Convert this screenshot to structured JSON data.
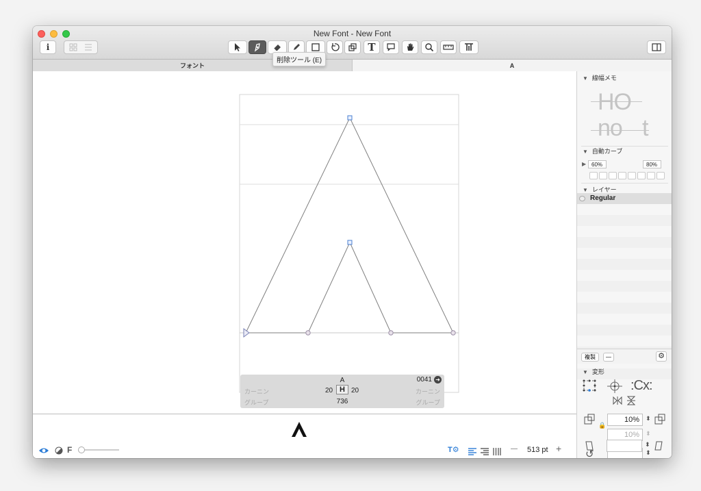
{
  "window": {
    "title": "New Font - New Font"
  },
  "toolbar": {
    "info_label": "i",
    "tooltip": "削除ツール (E)",
    "icons": [
      "info-icon",
      "grid-view-icon",
      "list-view-icon",
      "select-tool-icon",
      "node-tool-icon",
      "eraser-tool-icon",
      "pencil-tool-icon",
      "rectangle-tool-icon",
      "rotate-tool-icon",
      "scale-tool-icon",
      "text-tool-icon",
      "annotation-tool-icon",
      "hand-tool-icon",
      "zoom-tool-icon",
      "measure-tool-icon",
      "metrics-tool-icon",
      "sidebar-toggle-icon"
    ]
  },
  "tabs": [
    {
      "label": "フォント"
    },
    {
      "label": "A"
    }
  ],
  "glyph_info": {
    "name": "A",
    "unicode": "0041",
    "left_kern_label": "カーニン",
    "right_kern_label": "カーニン",
    "lsb": "20",
    "rsb": "20",
    "width": "736",
    "left_group_label": "グループ",
    "right_group_label": "グループ"
  },
  "panel": {
    "stem_memo": {
      "title": "線幅メモ",
      "sample1": "HO",
      "sample2": "no",
      "sample3": "t"
    },
    "auto_curve": {
      "title": "自動カーブ",
      "left_value": "60%",
      "right_value": "80%"
    },
    "layers": {
      "title": "レイヤー",
      "items": [
        {
          "name": "Regular"
        }
      ]
    },
    "copy_button": "複製",
    "minus_button": "—",
    "transform": {
      "title": "変形",
      "scale_value": "10%",
      "scale_value2": "10%",
      "rotate_value": "",
      "slant_value": ""
    }
  },
  "preview": {
    "glyph": "A"
  },
  "bottom_bar": {
    "f_label": "F",
    "zoom": "513 pt",
    "minus": "—",
    "plus": "+"
  },
  "colors": {
    "accent": "#2a7bd6",
    "path": "#8a8a8a",
    "node_blue": "#4a7fd0",
    "node_gray": "#9b8fa6"
  }
}
